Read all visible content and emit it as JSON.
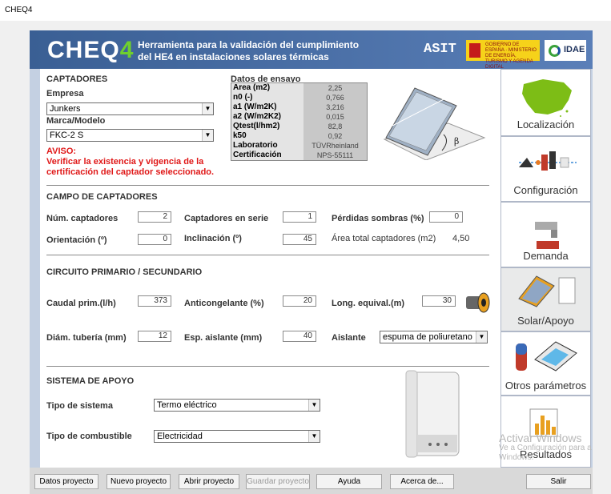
{
  "window": {
    "title": "CHEQ4"
  },
  "banner": {
    "logo_main": "CHEQ",
    "logo_num": "4",
    "tagline_1": "Herramienta para la validación del cumplimiento",
    "tagline_2": "del HE4 en instalaciones solares térmicas",
    "brand_asit": "ASIT",
    "brand_idae": "IDAE",
    "brand_gov": "GOBIERNO DE ESPAÑA · MINISTERIO DE ENERGÍA, TURISMO Y AGENDA DIGITAL"
  },
  "captadores": {
    "header": "CAPTADORES",
    "empresa_label": "Empresa",
    "empresa_value": "Junkers",
    "modelo_label": "Marca/Modelo",
    "modelo_value": "FKC-2 S",
    "aviso_title": "AVISO:",
    "aviso_line1": "Verificar la existencia y vigencia de la",
    "aviso_line2": "certificación del captador seleccionado."
  },
  "ensayo": {
    "title": "Datos de ensayo",
    "rows": [
      {
        "key": "Area (m2)",
        "value": "2,25"
      },
      {
        "key": "n0 (-)",
        "value": "0,766"
      },
      {
        "key": "a1 (W/m2K)",
        "value": "3,216"
      },
      {
        "key": "a2 (W/m2K2)",
        "value": "0,015"
      },
      {
        "key": "Qtest(l/hm2)",
        "value": "82,8"
      },
      {
        "key": "k50",
        "value": "0,92"
      },
      {
        "key": "Laboratorio",
        "value": "TÜVRheinland"
      },
      {
        "key": "Certificación",
        "value": "NPS-55111"
      }
    ],
    "beta_symbol": "β"
  },
  "campo": {
    "header": "CAMPO DE CAPTADORES",
    "num_label": "Núm. captadores",
    "num_value": "2",
    "serie_label": "Captadores en serie",
    "serie_value": "1",
    "sombras_label": "Pérdidas sombras (%)",
    "sombras_value": "0",
    "orient_label": "Orientación (º)",
    "orient_value": "0",
    "incl_label": "Inclinación (º)",
    "incl_value": "45",
    "area_label": "Área total captadores (m2)",
    "area_value": "4,50"
  },
  "circuito": {
    "header": "CIRCUITO PRIMARIO / SECUNDARIO",
    "caudal_label": "Caudal prim.(l/h)",
    "caudal_value": "373",
    "anticong_label": "Anticongelante (%)",
    "anticong_value": "20",
    "long_label": "Long. equival.(m)",
    "long_value": "30",
    "diam_label": "Diám. tubería (mm)",
    "diam_value": "12",
    "esp_label": "Esp. aislante (mm)",
    "esp_value": "40",
    "aislante_label": "Aislante",
    "aislante_value": "espuma de poliuretano"
  },
  "apoyo": {
    "header": "SISTEMA DE APOYO",
    "tipo_label": "Tipo de sistema",
    "tipo_value": "Termo eléctrico",
    "comb_label": "Tipo de combustible",
    "comb_value": "Electricidad"
  },
  "sidebar": [
    {
      "label": "Localización",
      "icon": "spain-map-icon"
    },
    {
      "label": "Configuración",
      "icon": "configuration-icon"
    },
    {
      "label": "Demanda",
      "icon": "faucet-icon"
    },
    {
      "label": "Solar/Apoyo",
      "icon": "solar-panel-icon"
    },
    {
      "label": "Otros parámetros",
      "icon": "tank-panel-icon"
    },
    {
      "label": "Resultados",
      "icon": "bar-chart-icon"
    }
  ],
  "buttons": {
    "datos": "Datos proyecto",
    "nuevo": "Nuevo proyecto",
    "abrir": "Abrir proyecto",
    "guardar": "Guardar proyecto",
    "ayuda": "Ayuda",
    "acerca": "Acerca de...",
    "salir": "Salir"
  },
  "watermark": {
    "line1": "Activar Windows",
    "line2": "Ve a Configuración para a",
    "line3": "Windows."
  },
  "colors": {
    "banner": "#3a5f94",
    "sidebar_bg": "#c4d0e2",
    "warning": "#e01818",
    "logo_accent": "#6fcf2d"
  }
}
